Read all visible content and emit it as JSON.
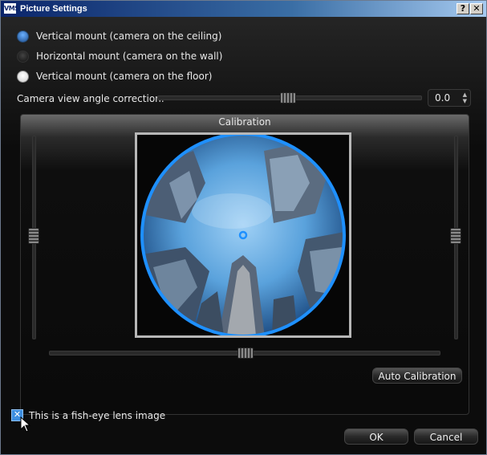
{
  "window": {
    "app_logo": "VMS",
    "title": "Picture Settings",
    "help_button": "?",
    "close_button": "✕"
  },
  "mount_options": [
    {
      "label": "Vertical mount (camera on the ceiling)",
      "state": "selected-blue"
    },
    {
      "label": "Horizontal mount (camera on the wall)",
      "state": "unselected"
    },
    {
      "label": "Vertical mount (camera on the floor)",
      "state": "selected-white"
    }
  ],
  "angle_correction": {
    "label": "Camera view angle correction:",
    "value": "0.0"
  },
  "calibration": {
    "title": "Calibration",
    "auto_button": "Auto Calibration",
    "fisheye_preview": "fisheye-city-image",
    "accent_color": "#1e90ff"
  },
  "fisheye_checkbox": {
    "label": "This is a fish-eye lens image",
    "checked": true
  },
  "footer": {
    "ok_label": "OK",
    "cancel_label": "Cancel"
  }
}
